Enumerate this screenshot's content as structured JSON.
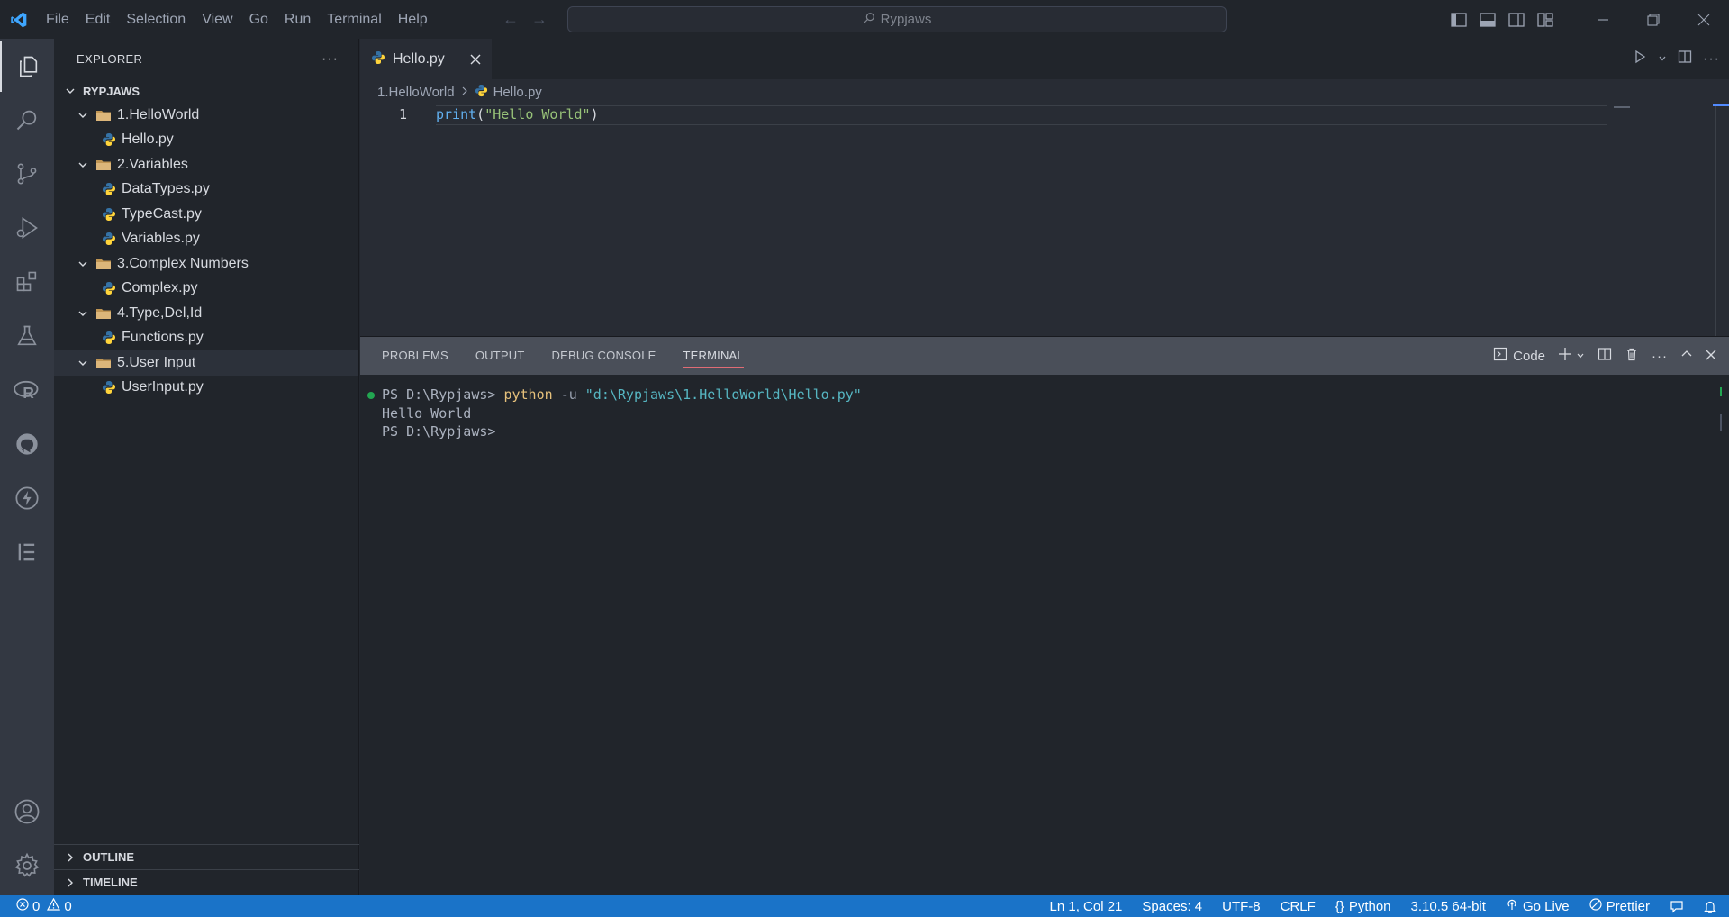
{
  "titlebar": {
    "menu": [
      "File",
      "Edit",
      "Selection",
      "View",
      "Go",
      "Run",
      "Terminal",
      "Help"
    ],
    "search_text": "Rypjaws"
  },
  "explorer": {
    "title": "EXPLORER",
    "more": "···",
    "root": "RYPJAWS",
    "tree": [
      {
        "type": "folder",
        "label": "1.HelloWorld"
      },
      {
        "type": "file",
        "label": "Hello.py"
      },
      {
        "type": "folder",
        "label": "2.Variables"
      },
      {
        "type": "file",
        "label": "DataTypes.py"
      },
      {
        "type": "file",
        "label": "TypeCast.py"
      },
      {
        "type": "file",
        "label": "Variables.py"
      },
      {
        "type": "folder",
        "label": "3.Complex Numbers"
      },
      {
        "type": "file",
        "label": "Complex.py"
      },
      {
        "type": "folder",
        "label": "4.Type,Del,Id"
      },
      {
        "type": "file",
        "label": "Functions.py"
      },
      {
        "type": "folder",
        "label": "5.User Input"
      },
      {
        "type": "file",
        "label": "UserInput.py"
      }
    ],
    "outline": "OUTLINE",
    "timeline": "TIMELINE"
  },
  "editor": {
    "tab_label": "Hello.py",
    "breadcrumb": [
      "1.HelloWorld",
      "Hello.py"
    ],
    "line_number": "1",
    "code": {
      "fn": "print",
      "open": "(",
      "str": "\"Hello World\"",
      "close": ")"
    }
  },
  "panel": {
    "tabs": [
      "PROBLEMS",
      "OUTPUT",
      "DEBUG CONSOLE",
      "TERMINAL"
    ],
    "active_tab": "TERMINAL",
    "terminal_profile": "Code",
    "terminal": {
      "prompt": "PS D:\\Rypjaws>",
      "cmd": "python",
      "flag": "-u",
      "path": "\"d:\\Rypjaws\\1.HelloWorld\\Hello.py\"",
      "output": "Hello World",
      "prompt2": "PS D:\\Rypjaws>"
    }
  },
  "statusbar": {
    "errors": "0",
    "warnings": "0",
    "position": "Ln 1, Col 21",
    "spaces": "Spaces: 4",
    "encoding": "UTF-8",
    "eol": "CRLF",
    "language": "Python",
    "interpreter": "3.10.5 64-bit",
    "golive": "Go Live",
    "prettier": "Prettier"
  },
  "colors": {
    "accent": "#1a73c8",
    "status_bar": "#1a73c8",
    "folder": "#dcb67a",
    "python_blue": "#3572a5",
    "python_yellow": "#ffd43b"
  }
}
